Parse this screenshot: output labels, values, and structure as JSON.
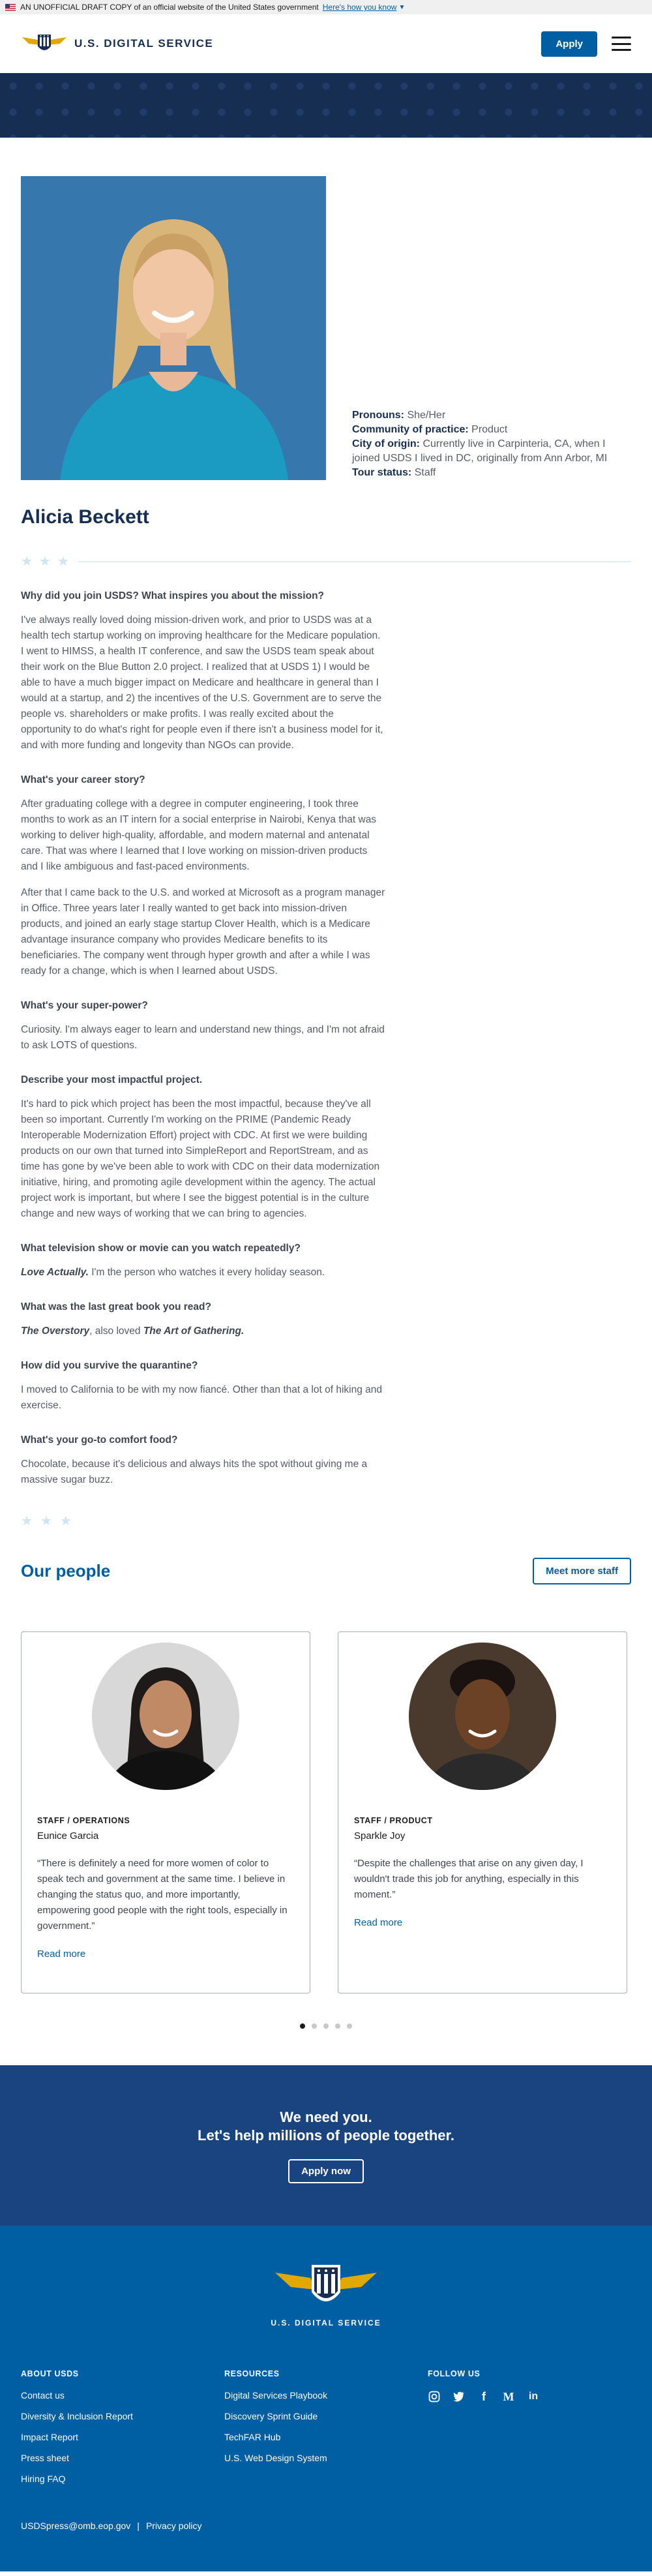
{
  "gov_banner": {
    "text": "AN UNOFFICIAL DRAFT COPY of an official website of the United States government",
    "link": "Here's how you know"
  },
  "header": {
    "logo_text": "U.S. DIGITAL SERVICE",
    "apply_label": "Apply"
  },
  "profile": {
    "pronouns_label": "Pronouns:",
    "pronouns": "She/Her",
    "practice_label": "Community of practice:",
    "practice": "Product",
    "origin_label": "City of origin:",
    "origin": "Currently live in Carpinteria, CA, when I joined USDS I lived in DC, originally from Ann Arbor, MI",
    "tour_label": "Tour status:",
    "tour": "Staff",
    "name": "Alicia Beckett"
  },
  "qa": [
    {
      "q": "Why did you join USDS? What inspires you about the mission?",
      "a": [
        "I've always really loved doing mission-driven work, and prior to USDS was at a health tech startup working on improving healthcare for the Medicare population. I went to HIMSS, a health IT conference, and saw the USDS team speak about their work on the Blue Button 2.0 project. I realized that at USDS 1) I would be able to have a much bigger impact on Medicare and healthcare in general than I would at a startup, and 2) the incentives of the U.S. Government are to serve the people vs. shareholders or make profits. I was really excited about the opportunity to do what's right for people even if there isn't a business model for it, and with more funding and longevity than NGOs can provide."
      ]
    },
    {
      "q": "What's your career story?",
      "a": [
        "After graduating college with a degree in computer engineering, I took three months to work as an IT intern for a social enterprise in Nairobi, Kenya that was working to deliver high-quality, affordable, and modern maternal and antenatal care. That was where I learned that I love working on mission-driven products and I like ambiguous and fast-paced environments.",
        "After that I came back to the U.S. and worked at Microsoft as a program manager in Office. Three years later I really wanted to get back into mission-driven products, and joined an early stage startup Clover Health, which is a Medicare advantage insurance company who provides Medicare benefits to its beneficiaries. The company went through hyper growth and after a while I was ready for a change, which is when I learned about USDS."
      ]
    },
    {
      "q": "What's your super-power?",
      "a": [
        "Curiosity. I'm always eager to learn and understand new things, and I'm not afraid to ask LOTS of questions."
      ]
    },
    {
      "q": "Describe your most impactful project.",
      "a": [
        "It's hard to pick which project has been the most impactful, because they've all been so important. Currently I'm working on the PRIME (Pandemic Ready Interoperable Modernization Effort) project with CDC. At first we were building products on our own that turned into SimpleReport and ReportStream, and as time has gone by we've been able to work with CDC on their data modernization initiative, hiring, and promoting agile development within the agency. The actual project work is important, but where I see the biggest potential is in the culture change and new ways of working that we can bring to agencies."
      ]
    },
    {
      "q": "What television show or movie can you watch repeatedly?",
      "em": "Love Actually.",
      "a": [
        " I'm the person who watches it every holiday season."
      ]
    },
    {
      "q": "What was the last great book you read?",
      "em": "The Overstory",
      "mid": ", also loved ",
      "em2": "The Art of Gathering."
    },
    {
      "q": "How did you survive the quarantine?",
      "a": [
        "I moved to California to be with my now fiancé. Other than that a lot of hiking and exercise."
      ]
    },
    {
      "q": "What's your go-to comfort food?",
      "a": [
        "Chocolate, because it's delicious and always hits the spot without giving me a massive sugar buzz."
      ]
    }
  ],
  "people": {
    "title": "Our people",
    "more_label": "Meet more staff",
    "cards": [
      {
        "role": "STAFF / OPERATIONS",
        "name": "Eunice Garcia",
        "quote": "“There is definitely a need for more women of color to speak tech and government at the same time. I believe in changing the status quo, and more importantly, empowering good people with the right tools, especially in government.”",
        "read": "Read more"
      },
      {
        "role": "STAFF / PRODUCT",
        "name": "Sparkle Joy",
        "quote": "“Despite the challenges that arise on any given day, I wouldn't trade this job for anything, especially in this moment.”",
        "read": "Read more"
      }
    ],
    "dots": 5,
    "active_dot": 1
  },
  "cta": {
    "line1": "We need you.",
    "line2": "Let's help millions of people together.",
    "button": "Apply now"
  },
  "footer": {
    "logo_text": "U.S. DIGITAL SERVICE",
    "about": {
      "title": "ABOUT USDS",
      "links": [
        "Contact us",
        "Diversity & Inclusion Report",
        "Impact Report",
        "Press sheet",
        "Hiring FAQ"
      ]
    },
    "resources": {
      "title": "RESOURCES",
      "links": [
        "Digital Services Playbook",
        "Discovery Sprint Guide",
        "TechFAR Hub",
        "U.S. Web Design System"
      ]
    },
    "follow": {
      "title": "FOLLOW US",
      "icons": [
        "instagram-icon",
        "twitter-icon",
        "facebook-icon",
        "medium-icon",
        "linkedin-icon"
      ]
    },
    "email": "USDSpress@omb.eop.gov",
    "separator": "|",
    "privacy": "Privacy policy"
  },
  "colors": {
    "navy": "#162e51",
    "primary": "#005ea2",
    "cta": "#1a4480"
  }
}
